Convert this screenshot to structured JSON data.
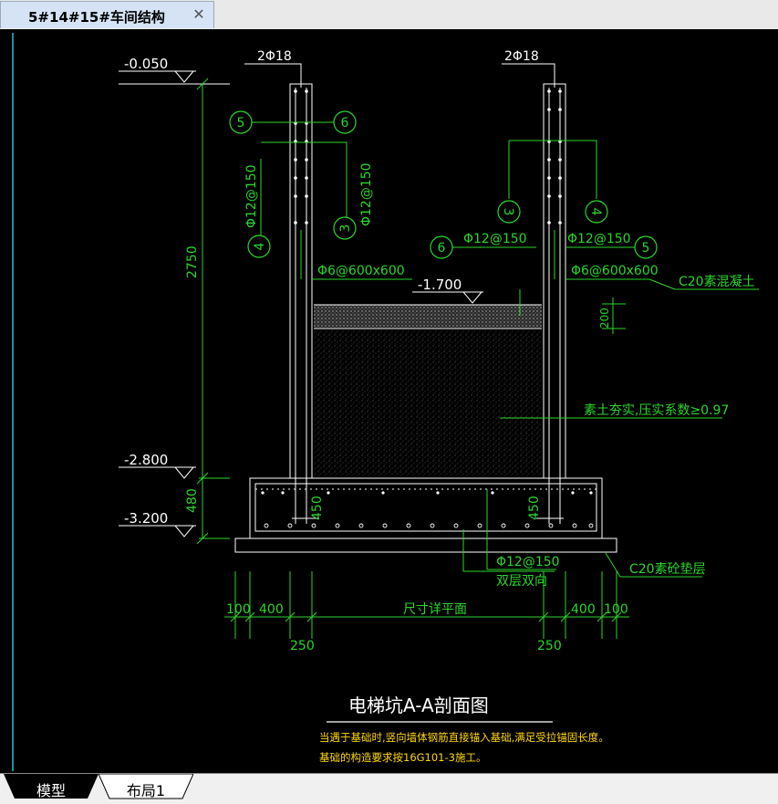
{
  "document_tab": {
    "title": "5#14#15#车间结构",
    "close_glyph": "✕"
  },
  "layout_tabs": [
    {
      "label": "模型",
      "active": true
    },
    {
      "label": "布局1",
      "active": false
    }
  ],
  "drawing": {
    "elevations": {
      "top": "-0.050",
      "mid": "-1.700",
      "base": "-2.800",
      "bottom": "-3.200"
    },
    "dimensions": {
      "wall_height": "2750",
      "base_thickness": "480",
      "fill_layer": "200",
      "anchor_left": "450",
      "anchor_right": "450",
      "d100_left": "100",
      "d400_left": "400",
      "span": "尺寸详平面",
      "d400_right": "400",
      "d100_right": "100",
      "wall_left": "250",
      "wall_right": "250"
    },
    "rebar": {
      "top_left": "2Φ18",
      "top_right": "2Φ18",
      "vertical_left": "Φ12@150",
      "horizontal_left": "Φ12@150",
      "vertical_right_a": "Φ12@150",
      "vertical_right_b": "Φ12@150",
      "tie_left": "Φ6@600x600",
      "tie_right": "Φ6@600x600",
      "slab": "Φ12@150",
      "slab_note": "双层双向"
    },
    "bubbles": {
      "l5": "5",
      "l6": "6",
      "l4": "4",
      "l3": "3",
      "r3": "3",
      "r4": "4",
      "r6": "6",
      "r5": "5"
    },
    "materials": {
      "concrete": "C20素混凝土",
      "soil": "素土夯实,压实系数≥0.97",
      "cushion": "C20素砼垫层"
    },
    "title": "电梯坑A-A剖面图",
    "notes": [
      "当遇于基础时,竖向墙体钢筋直接锚入基础,满足受拉锚固长度。",
      "基础的构造要求按16G101-3施工。"
    ]
  }
}
